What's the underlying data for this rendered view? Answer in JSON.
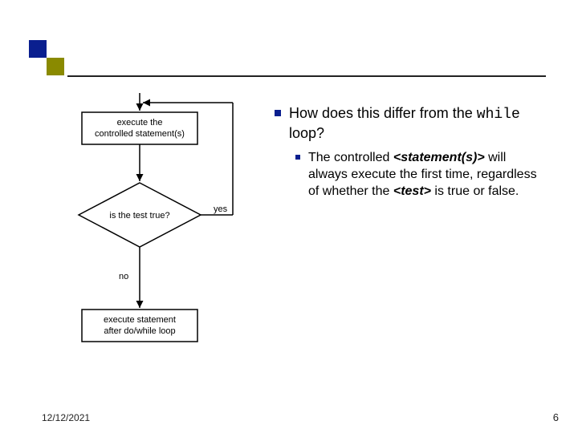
{
  "flow": {
    "box1": "execute the\ncontrolled statement(s)",
    "diamond": "is the test true?",
    "yes": "yes",
    "no": "no",
    "box2": "execute statement\nafter do/while loop"
  },
  "content": {
    "question_prefix": "How does this differ from the ",
    "question_mono": "while",
    "question_suffix": " loop?",
    "answer_pre": "The controlled ",
    "answer_em1": "<statement(s)>",
    "answer_mid": " will always execute the first time, regardless of whether the ",
    "answer_em2": "<test>",
    "answer_post": " is true or false."
  },
  "footer": {
    "date": "12/12/2021",
    "page": "6"
  }
}
